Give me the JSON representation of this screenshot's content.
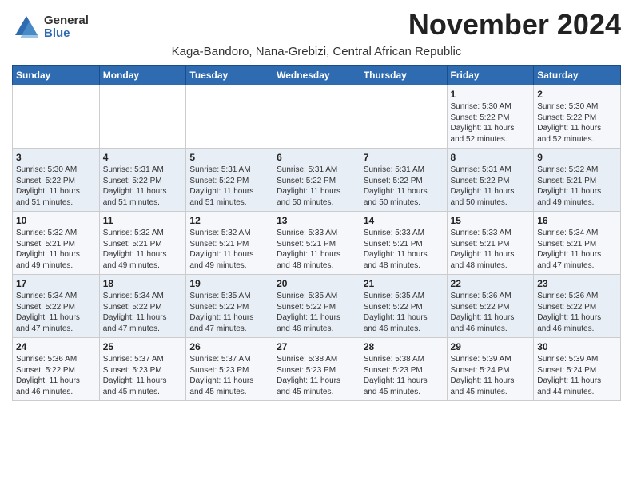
{
  "logo": {
    "general": "General",
    "blue": "Blue"
  },
  "title": "November 2024",
  "location": "Kaga-Bandoro, Nana-Grebizi, Central African Republic",
  "days_of_week": [
    "Sunday",
    "Monday",
    "Tuesday",
    "Wednesday",
    "Thursday",
    "Friday",
    "Saturday"
  ],
  "weeks": [
    [
      {
        "day": "",
        "content": ""
      },
      {
        "day": "",
        "content": ""
      },
      {
        "day": "",
        "content": ""
      },
      {
        "day": "",
        "content": ""
      },
      {
        "day": "",
        "content": ""
      },
      {
        "day": "1",
        "content": "Sunrise: 5:30 AM\nSunset: 5:22 PM\nDaylight: 11 hours\nand 52 minutes."
      },
      {
        "day": "2",
        "content": "Sunrise: 5:30 AM\nSunset: 5:22 PM\nDaylight: 11 hours\nand 52 minutes."
      }
    ],
    [
      {
        "day": "3",
        "content": "Sunrise: 5:30 AM\nSunset: 5:22 PM\nDaylight: 11 hours\nand 51 minutes."
      },
      {
        "day": "4",
        "content": "Sunrise: 5:31 AM\nSunset: 5:22 PM\nDaylight: 11 hours\nand 51 minutes."
      },
      {
        "day": "5",
        "content": "Sunrise: 5:31 AM\nSunset: 5:22 PM\nDaylight: 11 hours\nand 51 minutes."
      },
      {
        "day": "6",
        "content": "Sunrise: 5:31 AM\nSunset: 5:22 PM\nDaylight: 11 hours\nand 50 minutes."
      },
      {
        "day": "7",
        "content": "Sunrise: 5:31 AM\nSunset: 5:22 PM\nDaylight: 11 hours\nand 50 minutes."
      },
      {
        "day": "8",
        "content": "Sunrise: 5:31 AM\nSunset: 5:22 PM\nDaylight: 11 hours\nand 50 minutes."
      },
      {
        "day": "9",
        "content": "Sunrise: 5:32 AM\nSunset: 5:21 PM\nDaylight: 11 hours\nand 49 minutes."
      }
    ],
    [
      {
        "day": "10",
        "content": "Sunrise: 5:32 AM\nSunset: 5:21 PM\nDaylight: 11 hours\nand 49 minutes."
      },
      {
        "day": "11",
        "content": "Sunrise: 5:32 AM\nSunset: 5:21 PM\nDaylight: 11 hours\nand 49 minutes."
      },
      {
        "day": "12",
        "content": "Sunrise: 5:32 AM\nSunset: 5:21 PM\nDaylight: 11 hours\nand 49 minutes."
      },
      {
        "day": "13",
        "content": "Sunrise: 5:33 AM\nSunset: 5:21 PM\nDaylight: 11 hours\nand 48 minutes."
      },
      {
        "day": "14",
        "content": "Sunrise: 5:33 AM\nSunset: 5:21 PM\nDaylight: 11 hours\nand 48 minutes."
      },
      {
        "day": "15",
        "content": "Sunrise: 5:33 AM\nSunset: 5:21 PM\nDaylight: 11 hours\nand 48 minutes."
      },
      {
        "day": "16",
        "content": "Sunrise: 5:34 AM\nSunset: 5:21 PM\nDaylight: 11 hours\nand 47 minutes."
      }
    ],
    [
      {
        "day": "17",
        "content": "Sunrise: 5:34 AM\nSunset: 5:22 PM\nDaylight: 11 hours\nand 47 minutes."
      },
      {
        "day": "18",
        "content": "Sunrise: 5:34 AM\nSunset: 5:22 PM\nDaylight: 11 hours\nand 47 minutes."
      },
      {
        "day": "19",
        "content": "Sunrise: 5:35 AM\nSunset: 5:22 PM\nDaylight: 11 hours\nand 47 minutes."
      },
      {
        "day": "20",
        "content": "Sunrise: 5:35 AM\nSunset: 5:22 PM\nDaylight: 11 hours\nand 46 minutes."
      },
      {
        "day": "21",
        "content": "Sunrise: 5:35 AM\nSunset: 5:22 PM\nDaylight: 11 hours\nand 46 minutes."
      },
      {
        "day": "22",
        "content": "Sunrise: 5:36 AM\nSunset: 5:22 PM\nDaylight: 11 hours\nand 46 minutes."
      },
      {
        "day": "23",
        "content": "Sunrise: 5:36 AM\nSunset: 5:22 PM\nDaylight: 11 hours\nand 46 minutes."
      }
    ],
    [
      {
        "day": "24",
        "content": "Sunrise: 5:36 AM\nSunset: 5:22 PM\nDaylight: 11 hours\nand 46 minutes."
      },
      {
        "day": "25",
        "content": "Sunrise: 5:37 AM\nSunset: 5:23 PM\nDaylight: 11 hours\nand 45 minutes."
      },
      {
        "day": "26",
        "content": "Sunrise: 5:37 AM\nSunset: 5:23 PM\nDaylight: 11 hours\nand 45 minutes."
      },
      {
        "day": "27",
        "content": "Sunrise: 5:38 AM\nSunset: 5:23 PM\nDaylight: 11 hours\nand 45 minutes."
      },
      {
        "day": "28",
        "content": "Sunrise: 5:38 AM\nSunset: 5:23 PM\nDaylight: 11 hours\nand 45 minutes."
      },
      {
        "day": "29",
        "content": "Sunrise: 5:39 AM\nSunset: 5:24 PM\nDaylight: 11 hours\nand 45 minutes."
      },
      {
        "day": "30",
        "content": "Sunrise: 5:39 AM\nSunset: 5:24 PM\nDaylight: 11 hours\nand 44 minutes."
      }
    ]
  ]
}
